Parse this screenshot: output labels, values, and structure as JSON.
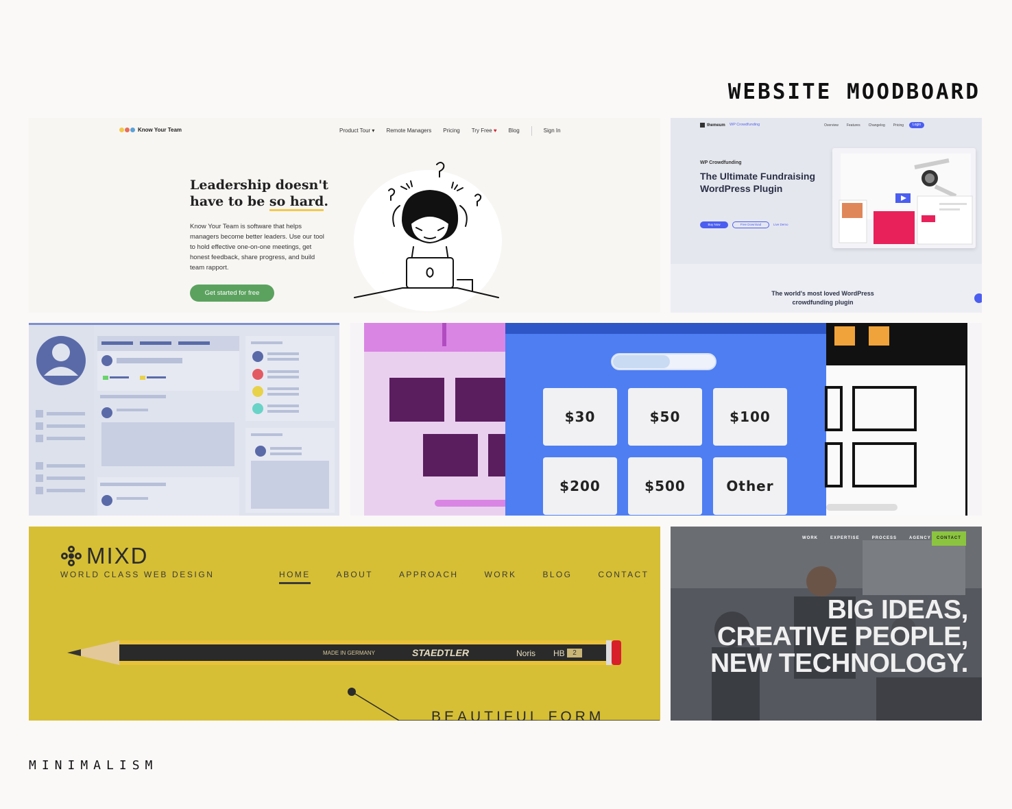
{
  "board": {
    "title": "WEBSITE MOODBOARD",
    "footer": "MINIMALISM"
  },
  "know_your_team": {
    "logo": "Know Your Team",
    "nav": [
      "Product Tour ▾",
      "Remote Managers",
      "Pricing",
      "Try Free",
      "Blog",
      "Sign In"
    ],
    "headline_a": "Leadership doesn't have to be ",
    "headline_b": "so hard",
    "headline_c": ".",
    "body": "Know Your Team is software that helps managers become better leaders. Use our tool to hold effective one-on-one meetings, get honest feedback, share progress, and build team rapport.",
    "cta": "Get started for free",
    "accent": "#5ba25f"
  },
  "crowdfunding": {
    "brand": "themeum",
    "product": "WP Crowdfunding",
    "menu": [
      "Overview",
      "Features",
      "Changelog",
      "Pricing"
    ],
    "login": "Login",
    "eyebrow": "WP Crowdfunding",
    "headline": "The Ultimate Fundraising WordPress Plugin",
    "buttons": [
      "Buy Now",
      "Free Download",
      "Live Demo"
    ],
    "tagline": "The world's most loved WordPress crowdfunding plugin",
    "accent": "#4b5ef0"
  },
  "donation": {
    "amounts": [
      "$30",
      "$50",
      "$100",
      "$200",
      "$500",
      "Other"
    ],
    "accent": "#4e7ef2",
    "progress": 0.56
  },
  "mixd": {
    "logo": "MIXD",
    "tagline": "WORLD CLASS WEB DESIGN",
    "nav": [
      "HOME",
      "ABOUT",
      "APPROACH",
      "WORK",
      "BLOG",
      "CONTACT"
    ],
    "active_nav": "HOME",
    "pencil_made": "MADE IN GERMANY",
    "pencil_brand": "STAEDTLER",
    "pencil_model": "Noris",
    "pencil_grade": "HB",
    "pencil_number": "2",
    "caption": "BEAUTIFUL FORM",
    "background": "#d6bf34"
  },
  "big_ideas": {
    "menu": [
      "WORK",
      "EXPERTISE",
      "PROCESS",
      "AGENCY"
    ],
    "contact": "CONTACT",
    "headline_lines": [
      "BIG IDEAS,",
      "CREATIVE PEOPLE,",
      "NEW TECHNOLOGY."
    ],
    "accent": "#8bc43f"
  }
}
